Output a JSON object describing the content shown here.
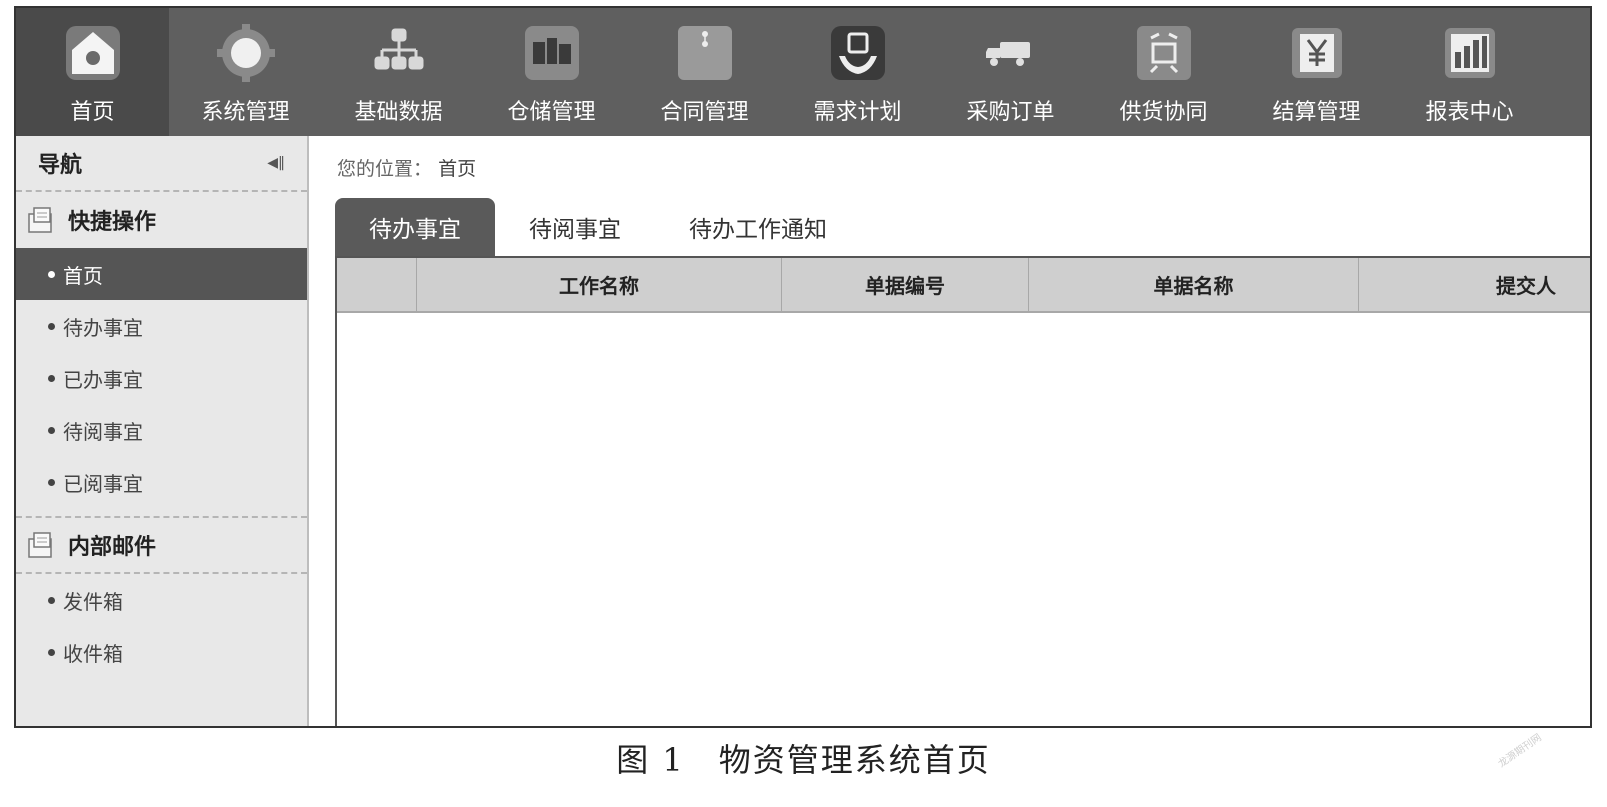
{
  "topnav": {
    "items": [
      {
        "label": "首页",
        "icon": "home-icon"
      },
      {
        "label": "系统管理",
        "icon": "gear-icon"
      },
      {
        "label": "基础数据",
        "icon": "hierarchy-icon"
      },
      {
        "label": "仓储管理",
        "icon": "warehouse-icon"
      },
      {
        "label": "合同管理",
        "icon": "contract-icon"
      },
      {
        "label": "需求计划",
        "icon": "demand-plan-icon"
      },
      {
        "label": "采购订单",
        "icon": "truck-icon"
      },
      {
        "label": "供货协同",
        "icon": "supply-icon"
      },
      {
        "label": "结算管理",
        "icon": "yen-icon"
      },
      {
        "label": "报表中心",
        "icon": "bar-chart-icon"
      }
    ],
    "active_index": 0
  },
  "sidebar": {
    "title": "导航",
    "groups": [
      {
        "title": "快捷操作",
        "items": [
          "首页",
          "待办事宜",
          "已办事宜",
          "待阅事宜",
          "已阅事宜"
        ],
        "active_index": 0
      },
      {
        "title": "内部邮件",
        "items": [
          "发件箱",
          "收件箱"
        ]
      }
    ]
  },
  "breadcrumb": {
    "label": "您的位置：",
    "current": "首页"
  },
  "tabs": [
    {
      "label": "待办事宜",
      "active": true
    },
    {
      "label": "待阅事宜",
      "active": false
    },
    {
      "label": "待办工作通知",
      "active": false
    }
  ],
  "grid": {
    "columns": [
      "",
      "工作名称",
      "单据编号",
      "单据名称",
      "提交人"
    ]
  },
  "caption": "图 1　物资管理系统首页",
  "watermark": "龙源期刊网",
  "colors": {
    "topbar": "#5f5f5f",
    "active_tab": "#5a5a5a",
    "sidebar_bg": "#e8e8e8",
    "grid_header": "#cfcfcf"
  }
}
